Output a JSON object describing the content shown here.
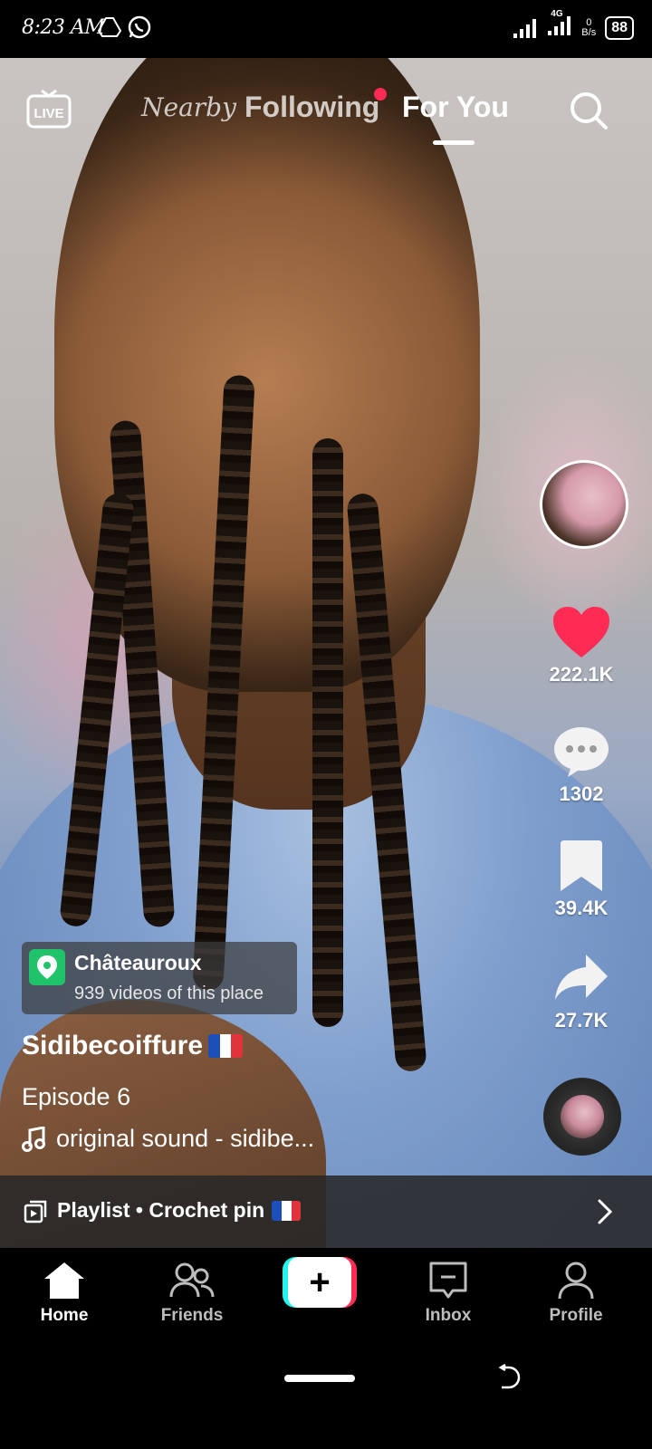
{
  "status_bar": {
    "time": "8:23 AM",
    "network": "4G",
    "net_speed_top": "0",
    "net_speed_bottom": "B/s",
    "battery": "88",
    "icons": [
      "drive-icon",
      "whatsapp-icon",
      "signal-icon",
      "signal-icon"
    ]
  },
  "top_nav": {
    "live_icon": "live-tv-icon",
    "tabs": [
      {
        "label": "Nearby",
        "active": false
      },
      {
        "label": "Following",
        "active": false,
        "has_notification_dot": true
      },
      {
        "label": "For You",
        "active": true
      }
    ],
    "search_icon": "search-icon"
  },
  "right_rail": {
    "avatar_icon": "creator-avatar",
    "likes": "222.1K",
    "comments": "1302",
    "saves": "39.4K",
    "shares": "27.7K",
    "like_color": "#fe2c55"
  },
  "post": {
    "location_name": "Châteauroux",
    "location_sub": "939 videos of this place",
    "username": "Sidibecoiffure",
    "caption": "Episode 6",
    "sound": "original sound - sidibe...",
    "playlist": "Playlist • Crochet pin"
  },
  "bottom_nav": {
    "items": [
      {
        "label": "Home",
        "icon": "home-icon",
        "active": true
      },
      {
        "label": "Friends",
        "icon": "friends-icon",
        "active": false
      },
      {
        "label": "",
        "icon": "plus-icon",
        "active": false
      },
      {
        "label": "Inbox",
        "icon": "inbox-icon",
        "active": false
      },
      {
        "label": "Profile",
        "icon": "profile-icon",
        "active": false
      }
    ]
  },
  "colors": {
    "accent_pink": "#fe2c55",
    "accent_cyan": "#25f4ee",
    "location_green": "#20c36a"
  }
}
